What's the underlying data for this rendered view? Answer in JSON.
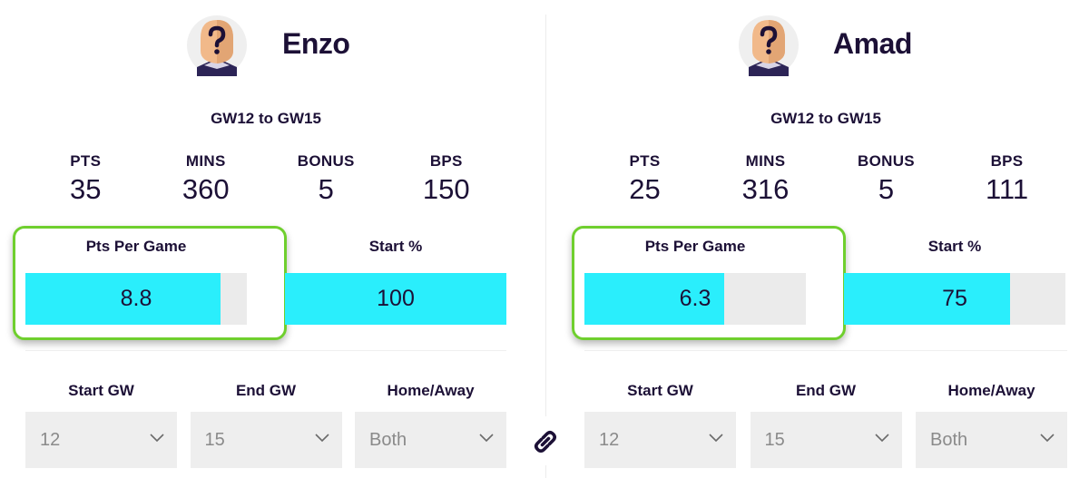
{
  "colors": {
    "text": "#1c1036",
    "bar_fill": "#2aeefc",
    "bar_track": "#ebebeb",
    "highlight_border": "#6fcf2e",
    "select_bg": "#eeeeee",
    "select_text": "#8a8a8a"
  },
  "link_icon": "link-icon",
  "players": [
    {
      "name": "Enzo",
      "avatar_icon": "unknown-player-avatar-icon",
      "range": "GW12 to GW15",
      "stats": [
        {
          "label": "PTS",
          "value": "35"
        },
        {
          "label": "MINS",
          "value": "360"
        },
        {
          "label": "BONUS",
          "value": "5"
        },
        {
          "label": "BPS",
          "value": "150"
        }
      ],
      "pts_per_game": {
        "label": "Pts Per Game",
        "value": "8.8",
        "fill_fraction": 0.88,
        "highlighted": true
      },
      "start_pct": {
        "label": "Start %",
        "value": "100",
        "fill_fraction": 1.0
      },
      "filters": [
        {
          "label": "Start GW",
          "value": "12"
        },
        {
          "label": "End GW",
          "value": "15"
        },
        {
          "label": "Home/Away",
          "value": "Both"
        }
      ]
    },
    {
      "name": "Amad",
      "avatar_icon": "unknown-player-avatar-icon",
      "range": "GW12 to GW15",
      "stats": [
        {
          "label": "PTS",
          "value": "25"
        },
        {
          "label": "MINS",
          "value": "316"
        },
        {
          "label": "BONUS",
          "value": "5"
        },
        {
          "label": "BPS",
          "value": "111"
        }
      ],
      "pts_per_game": {
        "label": "Pts Per Game",
        "value": "6.3",
        "fill_fraction": 0.63,
        "highlighted": true
      },
      "start_pct": {
        "label": "Start %",
        "value": "75",
        "fill_fraction": 0.75
      },
      "filters": [
        {
          "label": "Start GW",
          "value": "12"
        },
        {
          "label": "End GW",
          "value": "15"
        },
        {
          "label": "Home/Away",
          "value": "Both"
        }
      ]
    }
  ]
}
